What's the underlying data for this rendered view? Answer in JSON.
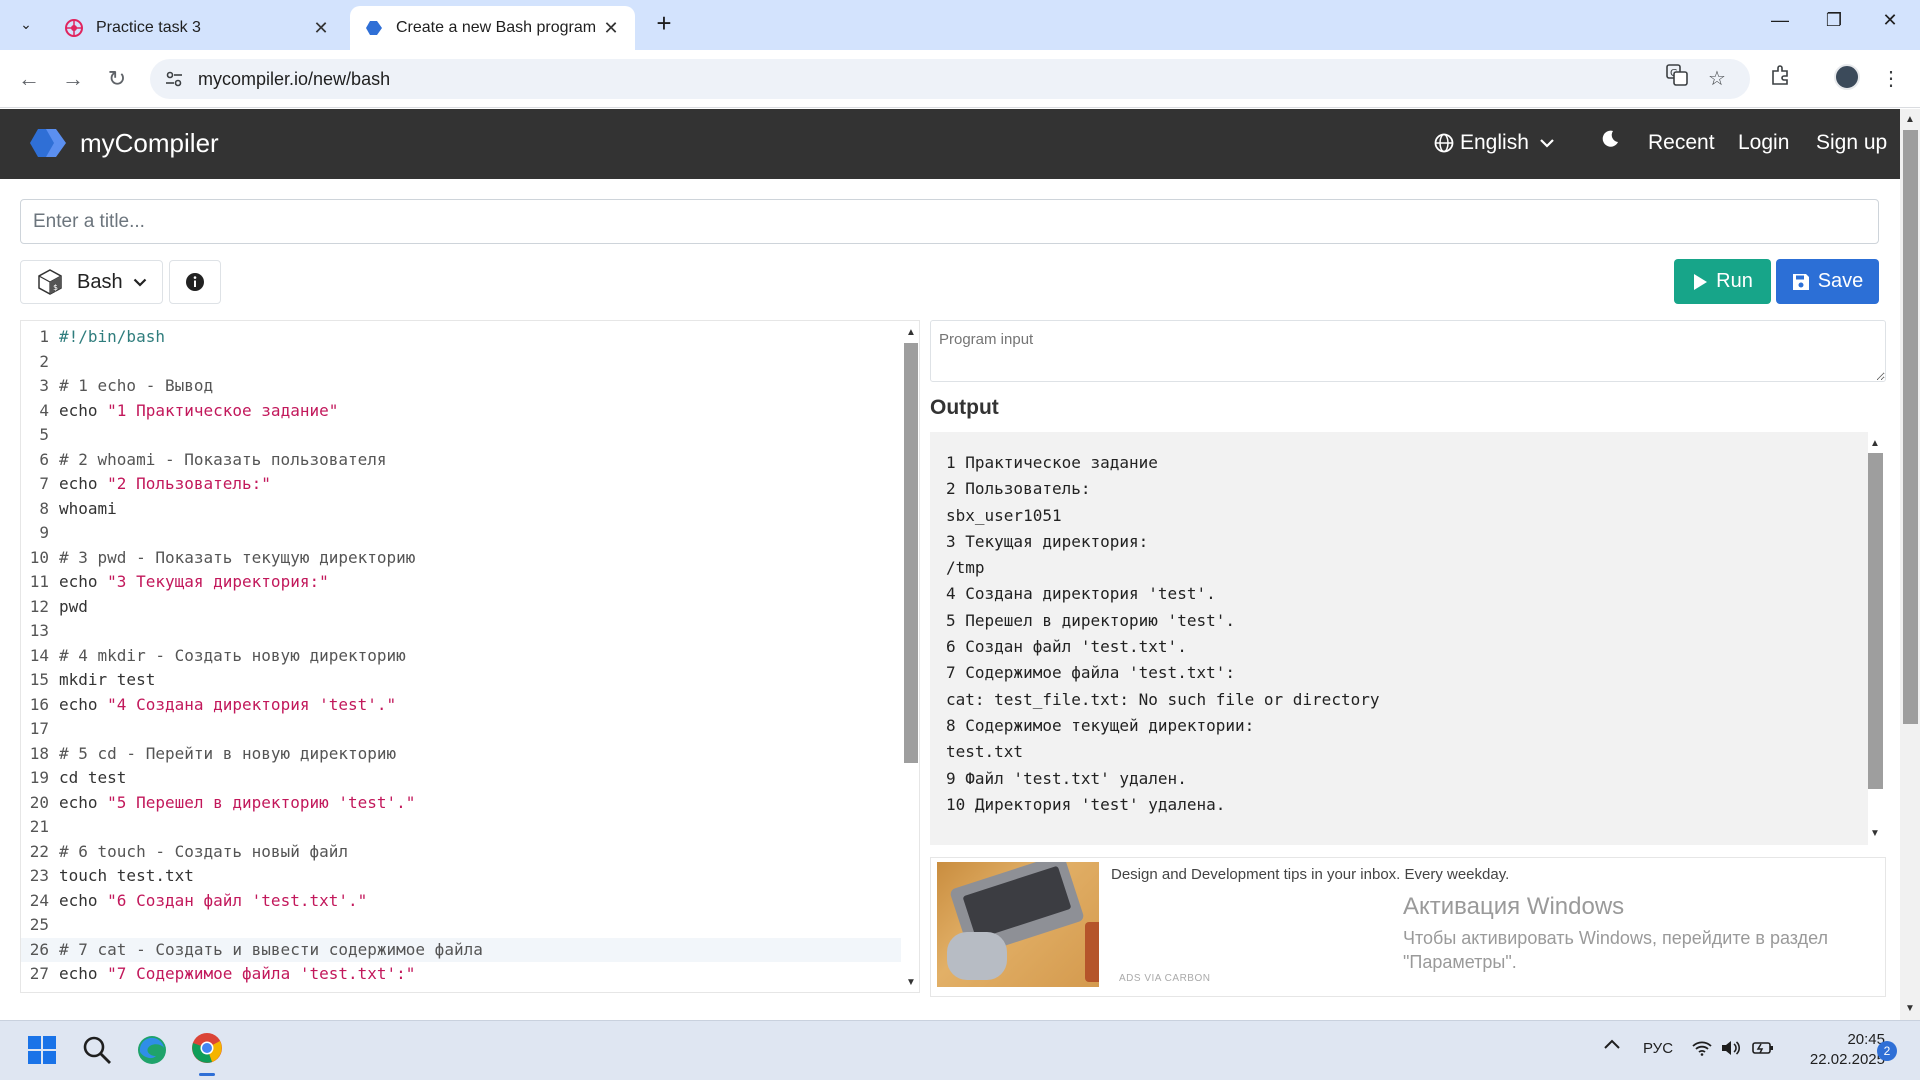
{
  "browser": {
    "tabs": [
      {
        "title": "Practice task 3",
        "active": false
      },
      {
        "title": "Create a new Bash program - m",
        "active": true
      }
    ],
    "url": "mycompiler.io/new/bash"
  },
  "header": {
    "brand": "myCompiler",
    "language": "English",
    "nav": {
      "recent": "Recent",
      "login": "Login",
      "signup": "Sign up"
    }
  },
  "editor_page": {
    "title_placeholder": "Enter a title...",
    "language_button": "Bash",
    "run_label": "Run",
    "save_label": "Save",
    "program_input_placeholder": "Program input",
    "output_label": "Output"
  },
  "code": [
    {
      "n": "1",
      "kind": "shebang",
      "text": "#!/bin/bash"
    },
    {
      "n": "2",
      "kind": "plain",
      "text": ""
    },
    {
      "n": "3",
      "kind": "comment",
      "text": "# 1 echo - Вывод"
    },
    {
      "n": "4",
      "kind": "echo",
      "cmd": "echo ",
      "str": "\"1 Практическое задание\""
    },
    {
      "n": "5",
      "kind": "plain",
      "text": ""
    },
    {
      "n": "6",
      "kind": "comment",
      "text": "# 2 whoami - Показать пользователя"
    },
    {
      "n": "7",
      "kind": "echo",
      "cmd": "echo ",
      "str": "\"2 Пользователь:\""
    },
    {
      "n": "8",
      "kind": "plain",
      "text": "whoami"
    },
    {
      "n": "9",
      "kind": "plain",
      "text": ""
    },
    {
      "n": "10",
      "kind": "comment",
      "text": "# 3 pwd - Показать текущую директорию"
    },
    {
      "n": "11",
      "kind": "echo",
      "cmd": "echo ",
      "str": "\"3 Текущая директория:\""
    },
    {
      "n": "12",
      "kind": "plain",
      "text": "pwd"
    },
    {
      "n": "13",
      "kind": "plain",
      "text": ""
    },
    {
      "n": "14",
      "kind": "comment",
      "text": "# 4 mkdir - Создать новую директорию"
    },
    {
      "n": "15",
      "kind": "plain",
      "text": "mkdir test"
    },
    {
      "n": "16",
      "kind": "echo",
      "cmd": "echo ",
      "str": "\"4 Создана директория 'test'.\""
    },
    {
      "n": "17",
      "kind": "plain",
      "text": ""
    },
    {
      "n": "18",
      "kind": "comment",
      "text": "# 5 cd - Перейти в новую директорию"
    },
    {
      "n": "19",
      "kind": "plain",
      "text": "cd test"
    },
    {
      "n": "20",
      "kind": "echo",
      "cmd": "echo ",
      "str": "\"5 Перешел в директорию 'test'.\""
    },
    {
      "n": "21",
      "kind": "plain",
      "text": ""
    },
    {
      "n": "22",
      "kind": "comment",
      "text": "# 6 touch - Создать новый файл"
    },
    {
      "n": "23",
      "kind": "plain",
      "text": "touch test.txt"
    },
    {
      "n": "24",
      "kind": "echo",
      "cmd": "echo ",
      "str": "\"6 Создан файл 'test.txt'.\""
    },
    {
      "n": "25",
      "kind": "plain",
      "text": ""
    },
    {
      "n": "26",
      "kind": "comment",
      "text": "# 7 cat - Создать и вывести содержимое файла",
      "highlight": true
    },
    {
      "n": "27",
      "kind": "echo",
      "cmd": "echo ",
      "str": "\"7 Содержимое файла 'test.txt':\""
    }
  ],
  "output": [
    "1 Практическое задание",
    "2 Пользователь:",
    "sbx_user1051",
    "3 Текущая директория:",
    "/tmp",
    "4 Создана директория 'test'.",
    "5 Перешел в директорию 'test'.",
    "6 Создан файл 'test.txt'.",
    "7 Содержимое файла 'test.txt':",
    "cat: test_file.txt: No such file or directory",
    "8 Содержимое текущей директории:",
    "test.txt",
    "9 Файл 'test.txt' удален.",
    "10 Директория 'test' удалена."
  ],
  "ad": {
    "text": "Design and Development tips in your inbox. Every weekday.",
    "via": "ADS VIA CARBON"
  },
  "watermark": {
    "title": "Активация Windows",
    "text": "Чтобы активировать Windows, перейдите в раздел \"Параметры\"."
  },
  "taskbar": {
    "lang": "РУС",
    "time": "20:45",
    "date": "22.02.2025",
    "notifications": "2"
  },
  "colors": {
    "header_bg": "#333333",
    "run": "#17a589",
    "save": "#2c6fd6",
    "string": "#c2185b",
    "brand_blue": "#2f6fd6"
  }
}
